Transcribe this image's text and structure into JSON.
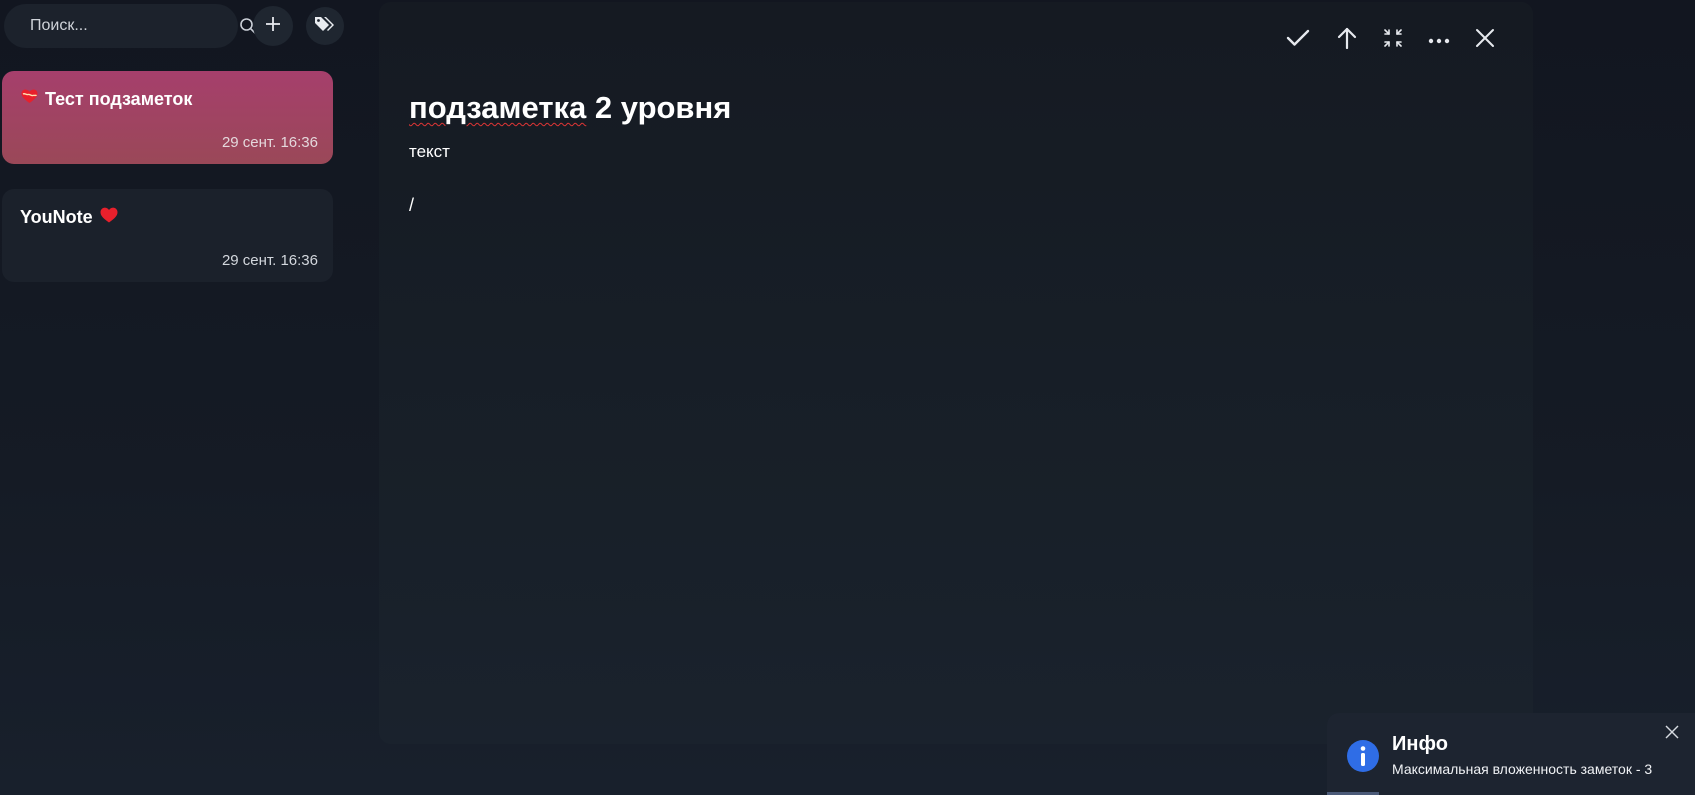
{
  "sidebar": {
    "search": {
      "placeholder": "Поиск...",
      "value": ""
    },
    "add_button_icon": "plus-icon",
    "tags_button_icon": "tags-icon",
    "notes": [
      {
        "title": "Тест подзаметок",
        "emoji": "heart-on-fire-icon",
        "date": "29 сент. 16:36",
        "active": true
      },
      {
        "title": "YouNote",
        "emoji": "red-heart-icon",
        "date": "29 сент. 16:36",
        "active": false
      }
    ]
  },
  "editor": {
    "toolbar": [
      "check-icon",
      "arrow-up-icon",
      "collapse-icon",
      "more-icon",
      "close-icon"
    ],
    "title_misspelled": "подзаметка",
    "title_rest": " 2 уровня",
    "body_line1": "текст",
    "body_line2": "/"
  },
  "toast": {
    "icon": "info-icon",
    "title": "Инфо",
    "message": "Максимальная вложенность заметок - 3",
    "progress": 0.14
  },
  "colors": {
    "active_card": "#a63f6c",
    "toast_icon": "#2f6de6",
    "heart": "#e8202c"
  }
}
